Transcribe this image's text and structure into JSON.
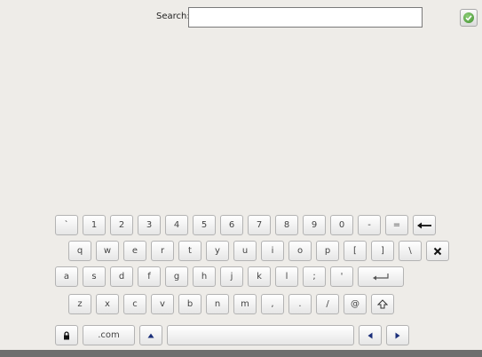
{
  "search": {
    "label": "Search:",
    "value": "",
    "placeholder": ""
  },
  "keyboard": {
    "row1": [
      "`",
      "1",
      "2",
      "3",
      "4",
      "5",
      "6",
      "7",
      "8",
      "9",
      "0",
      "-",
      "="
    ],
    "row2": [
      "q",
      "w",
      "e",
      "r",
      "t",
      "y",
      "u",
      "i",
      "o",
      "p",
      "[",
      "]",
      "\\"
    ],
    "row3": [
      "a",
      "s",
      "d",
      "f",
      "g",
      "h",
      "j",
      "k",
      "l",
      ";",
      "'"
    ],
    "row4": [
      "z",
      "x",
      "c",
      "v",
      "b",
      "n",
      "m",
      ",",
      ".",
      "/",
      "@"
    ],
    "com_label": ".com",
    "icons": {
      "ok": "check-circle-icon",
      "backspace": "backspace-arrow-icon",
      "clear": "x-icon",
      "enter": "enter-return-icon",
      "shift": "shift-arrow-icon",
      "lock": "lock-icon",
      "up": "triangle-up-icon",
      "left": "triangle-left-icon",
      "right": "triangle-right-icon"
    }
  },
  "colors": {
    "background": "#eeece8",
    "icon_navy": "#1b2f7a",
    "ok_green": "#3e8e2c",
    "bottom_bar": "#6e6e6e"
  }
}
